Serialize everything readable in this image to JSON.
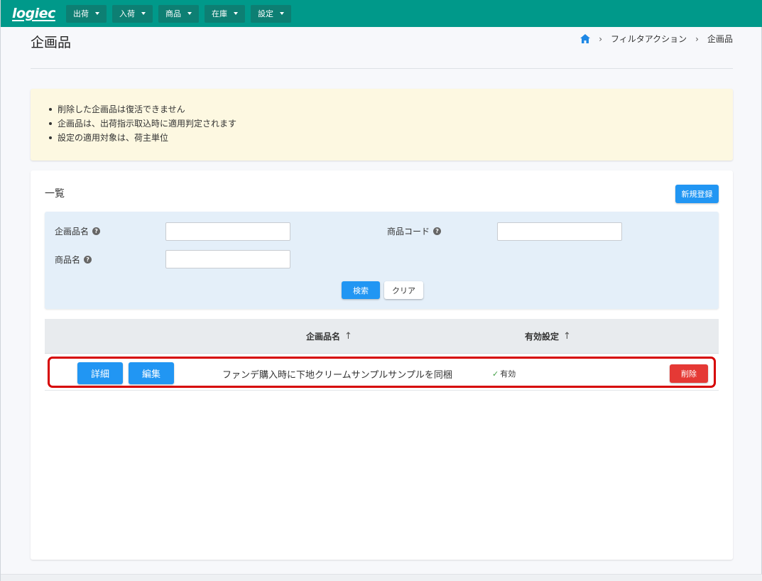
{
  "app": {
    "logo": "logiec"
  },
  "nav": {
    "items": [
      {
        "label": "出荷"
      },
      {
        "label": "入荷"
      },
      {
        "label": "商品"
      },
      {
        "label": "在庫"
      },
      {
        "label": "設定"
      }
    ]
  },
  "header": {
    "title": "企画品",
    "breadcrumb": [
      "フィルタアクション",
      "企画品"
    ]
  },
  "notice": {
    "items": [
      "削除した企画品は復活できません",
      "企画品は、出荷指示取込時に適用判定されます",
      "設定の適用対象は、荷主単位"
    ]
  },
  "list": {
    "title": "一覧",
    "new_button": "新規登録"
  },
  "search": {
    "field_plan_name_label": "企画品名",
    "field_product_code_label": "商品コード",
    "field_product_name_label": "商品名",
    "field_plan_name_value": "",
    "field_product_code_value": "",
    "field_product_name_value": "",
    "search_button": "検索",
    "clear_button": "クリア"
  },
  "table": {
    "columns": {
      "plan_name": "企画品名",
      "active": "有効設定"
    },
    "sort_arrow": "↑",
    "rows": [
      {
        "detail_button": "詳細",
        "edit_button": "編集",
        "plan_name": "ファンデ購入時に下地クリームサンプルサンプルを同梱",
        "status_icon": "✓",
        "status": "有効",
        "delete_button": "削除"
      }
    ]
  },
  "colors": {
    "navbar": "#00998a",
    "primary": "#2196f3",
    "danger": "#e53935",
    "notice_bg": "#fdf8e1",
    "search_bg": "#e4eff9",
    "highlight": "#d60000"
  }
}
